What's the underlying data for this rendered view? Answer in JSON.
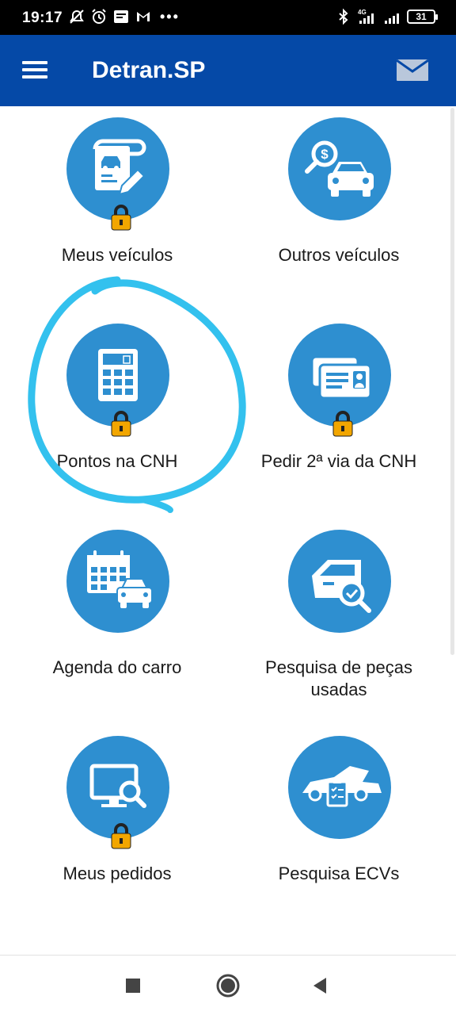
{
  "status_bar": {
    "time": "19:17",
    "battery": "31",
    "left_icons": [
      "mute-icon",
      "alarm-icon",
      "notification-icon",
      "gmail-icon"
    ],
    "right_icons": [
      "bluetooth-icon",
      "signal-4g-icon",
      "signal-icon",
      "battery-icon"
    ],
    "more": "•••"
  },
  "app_bar": {
    "title": "Detran.SP",
    "menu_icon": "menu-icon",
    "mail_icon": "mail-icon",
    "color": "#0549A7"
  },
  "tiles": [
    {
      "label": "Meus veículos",
      "icon": "vehicle-document-icon",
      "locked": true
    },
    {
      "label": "Outros veículos",
      "icon": "car-search-money-icon",
      "locked": false
    },
    {
      "label": "Pontos na CNH",
      "icon": "calculator-icon",
      "locked": true,
      "highlighted": true
    },
    {
      "label": "Pedir 2ª via da CNH",
      "icon": "license-cards-icon",
      "locked": true
    },
    {
      "label": "Agenda do carro",
      "icon": "calendar-car-icon",
      "locked": false
    },
    {
      "label": "Pesquisa de peças usadas",
      "icon": "car-door-search-icon",
      "locked": false
    },
    {
      "label": "Meus pedidos",
      "icon": "monitor-search-icon",
      "locked": true
    },
    {
      "label": "Pesquisa ECVs",
      "icon": "car-inspection-icon",
      "locked": false
    }
  ],
  "colors": {
    "accent": "#2E8FD0",
    "lock": "#F2A600",
    "highlight_stroke": "#33C1EE"
  },
  "nav_bar": {
    "buttons": [
      "recents-icon",
      "home-icon",
      "back-icon"
    ]
  }
}
